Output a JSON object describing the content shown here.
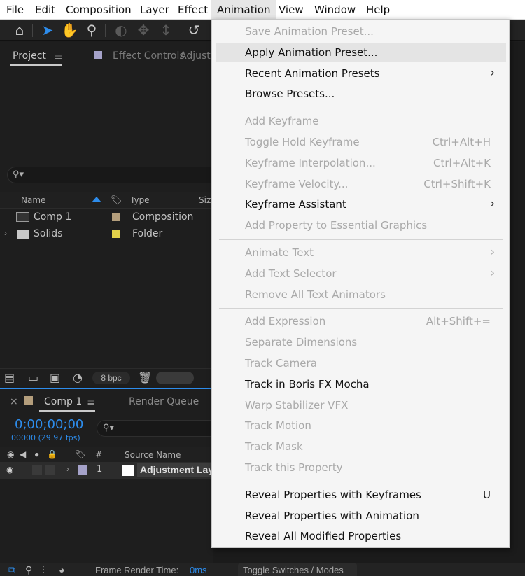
{
  "menubar": {
    "items": [
      "File",
      "Edit",
      "Composition",
      "Layer",
      "Effect",
      "Animation",
      "View",
      "Window",
      "Help"
    ]
  },
  "project_panel": {
    "tab_project": "Project",
    "tab_effect_controls": "Effect Controls",
    "effect_controls_target": "Adjustm",
    "columns": {
      "name": "Name",
      "type": "Type",
      "size": "Size"
    },
    "items": [
      {
        "name": "Comp 1",
        "type": "Composition",
        "color": "#b49e7c"
      },
      {
        "name": "Solids",
        "type": "Folder",
        "color": "#e3d14a"
      }
    ],
    "bit_depth": "8 bpc"
  },
  "timeline_panel": {
    "tab_comp": "Comp 1",
    "tab_render_queue": "Render Queue",
    "close_symbol": "×",
    "timecode": "0;00;00;00",
    "frame_info": "00000 (29.97 fps)",
    "columns": {
      "number": "#",
      "source_name": "Source Name"
    },
    "layer": {
      "index": "1",
      "name": "Adjustment Lay"
    },
    "frame_render_label": "Frame Render Time:",
    "frame_render_value": "0ms",
    "toggle_label": "Toggle Switches / Modes"
  },
  "animation_menu": {
    "groups": [
      [
        {
          "label": "Save Animation Preset...",
          "disabled": true
        },
        {
          "label": "Apply Animation Preset...",
          "hover": true
        },
        {
          "label": "Recent Animation Presets",
          "submenu": true
        },
        {
          "label": "Browse Presets..."
        }
      ],
      [
        {
          "label": "Add Keyframe",
          "disabled": true
        },
        {
          "label": "Toggle Hold Keyframe",
          "shortcut": "Ctrl+Alt+H",
          "disabled": true
        },
        {
          "label": "Keyframe Interpolation...",
          "shortcut": "Ctrl+Alt+K",
          "disabled": true
        },
        {
          "label": "Keyframe Velocity...",
          "shortcut": "Ctrl+Shift+K",
          "disabled": true
        },
        {
          "label": "Keyframe Assistant",
          "submenu": true
        },
        {
          "label": "Add Property to Essential Graphics",
          "disabled": true
        }
      ],
      [
        {
          "label": "Animate Text",
          "submenu": true,
          "disabled": true
        },
        {
          "label": "Add Text Selector",
          "submenu": true,
          "disabled": true
        },
        {
          "label": "Remove All Text Animators",
          "disabled": true
        }
      ],
      [
        {
          "label": "Add Expression",
          "shortcut": "Alt+Shift+=",
          "disabled": true
        },
        {
          "label": "Separate Dimensions",
          "disabled": true
        },
        {
          "label": "Track Camera",
          "disabled": true
        },
        {
          "label": "Track in Boris FX Mocha"
        },
        {
          "label": "Warp Stabilizer VFX",
          "disabled": true
        },
        {
          "label": "Track Motion",
          "disabled": true
        },
        {
          "label": "Track Mask",
          "disabled": true
        },
        {
          "label": "Track this Property",
          "disabled": true
        }
      ],
      [
        {
          "label": "Reveal Properties with Keyframes",
          "shortcut": "U"
        },
        {
          "label": "Reveal Properties with Animation"
        },
        {
          "label": "Reveal All Modified Properties"
        }
      ]
    ]
  }
}
